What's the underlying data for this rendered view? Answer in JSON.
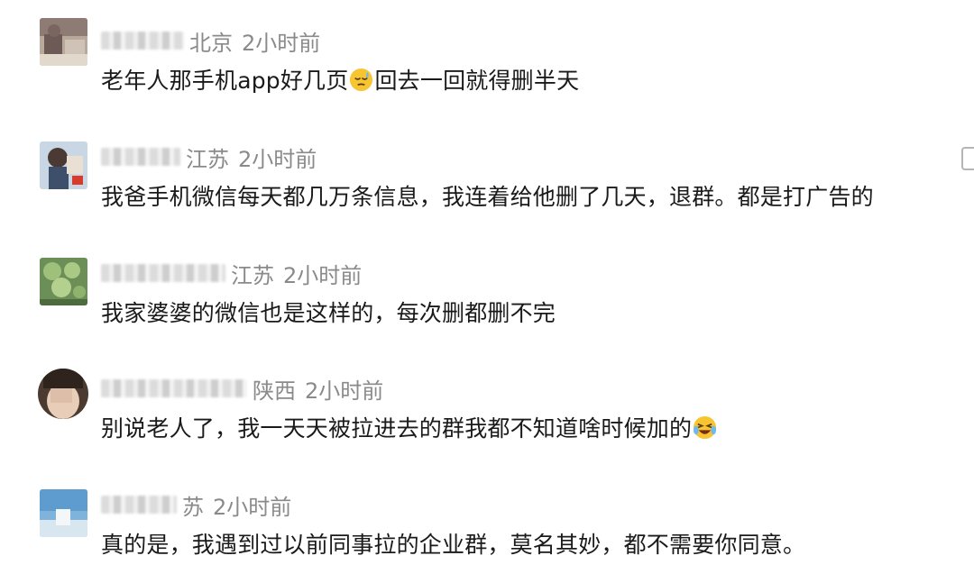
{
  "comments": [
    {
      "location": "北京",
      "time": "2小时前",
      "text_before": "老年人那手机app好几页",
      "emoji": "sleepy-face-emoji",
      "text_after": "回去一回就得删半天"
    },
    {
      "location": "江苏",
      "time": "2小时前",
      "text_before": "我爸手机微信每天都几万条信息，我连着给他删了几天，退群。都是打广告的",
      "emoji": "",
      "text_after": ""
    },
    {
      "location": "江苏",
      "time": "2小时前",
      "text_before": "我家婆婆的微信也是这样的，每次删都删不完",
      "emoji": "",
      "text_after": ""
    },
    {
      "location": "陕西",
      "time": "2小时前",
      "text_before": "别说老人了，我一天天被拉进去的群我都不知道啥时候加的",
      "emoji": "laughing-crying-emoji",
      "text_after": ""
    },
    {
      "location": "苏",
      "time": "2小时前",
      "text_before": "真的是，我遇到过以前同事拉的企业群，莫名其妙，都不需要你同意。",
      "emoji": "",
      "text_after": ""
    }
  ],
  "colors": {
    "meta_text": "#8a8a8a",
    "body_text": "#1a1a1a",
    "emoji_yellow": "#f7c531"
  }
}
